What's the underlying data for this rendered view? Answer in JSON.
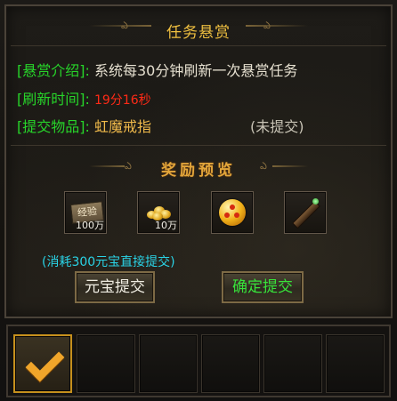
{
  "dialog": {
    "title": "任务悬赏",
    "rows": [
      {
        "label": "[悬赏介绍]:",
        "value": "系统每30分钟刷新一次悬赏任务"
      },
      {
        "label": "[刷新时间]:",
        "value": "19分16秒"
      },
      {
        "label": "[提交物品]:",
        "value": "虹魔戒指",
        "status": "(未提交)"
      }
    ],
    "reward_title": "奖励预览",
    "rewards": [
      {
        "icon": "experience-scroll-icon",
        "icon_text": "经验",
        "count": "100万"
      },
      {
        "icon": "gold-coins-icon",
        "count": "10万"
      },
      {
        "icon": "dragon-ball-orb-icon",
        "count": ""
      },
      {
        "icon": "magic-wand-icon",
        "count": ""
      }
    ],
    "hint": "(消耗300元宝直接提交)",
    "button_yuanbao": "元宝提交",
    "button_confirm": "确定提交"
  },
  "quickbar": {
    "active_icon": "checkmark-icon",
    "slot_count": 6
  },
  "colors": {
    "title": "#f0c040",
    "label_green": "#27d52a",
    "timer_red": "#ff2a16",
    "item_gold": "#efb94a",
    "hint_cyan": "#2ad3e6",
    "confirm_green": "#38e23a"
  }
}
